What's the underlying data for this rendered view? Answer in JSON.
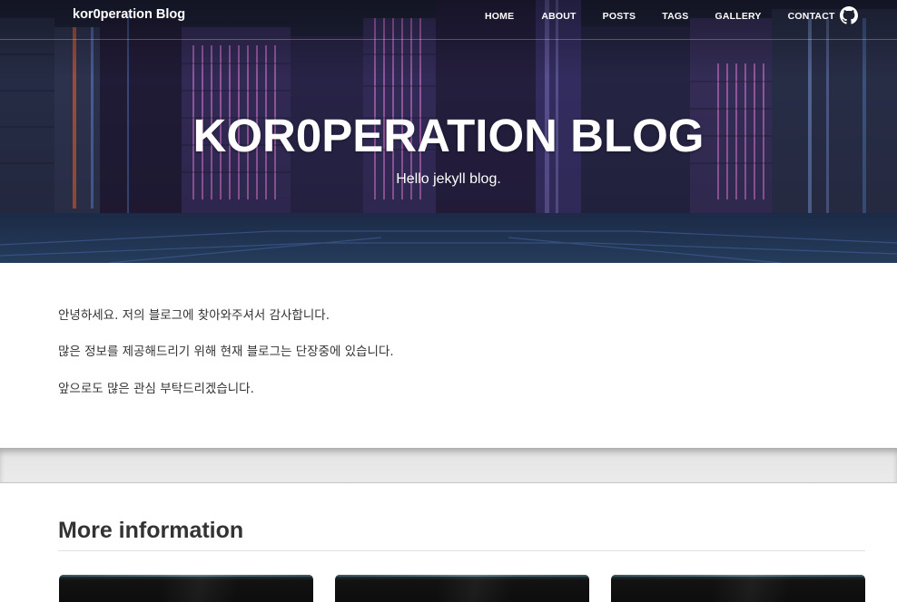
{
  "navbar": {
    "brand": "kor0peration Blog",
    "links": [
      "HOME",
      "ABOUT",
      "POSTS",
      "TAGS",
      "GALLERY",
      "CONTACT"
    ],
    "github_icon": "github-icon"
  },
  "hero": {
    "title": "KOR0PERATION BLOG",
    "subtitle": "Hello jekyll blog."
  },
  "intro": {
    "lines": [
      "안녕하세요. 저의 블로그에 찾아와주셔서 감사합니다.",
      "많은 정보를 제공해드리기 위해 현재 블로그는 단장중에 있습니다.",
      "앞으로도 많은 관심 부탁드리겠습니다."
    ]
  },
  "more": {
    "title": "More information",
    "card_count_visible": 3
  },
  "colors": {
    "hero_tint": "#2b2a55",
    "text": "#333333",
    "white": "#ffffff",
    "band": "#e6e6e6"
  }
}
